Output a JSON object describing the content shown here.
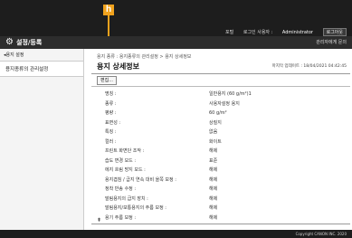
{
  "header": {
    "links": [
      "포털",
      "로그인 사용자 :",
      "Administrator",
      "로그아웃"
    ],
    "logout_button": "로그아웃"
  },
  "callout": {
    "label": "h"
  },
  "appbar": {
    "title": "설정/등록",
    "portal_link": "관리자에게 문의"
  },
  "sidebar": {
    "back_label": "◂용지 설정",
    "items": [
      {
        "label": "용지종류의 관리설정"
      }
    ]
  },
  "main": {
    "breadcrumb": "용지 종류 : 용지종류의 관리설정 > 용지 상세정보",
    "title": "용지 상세정보",
    "updated": "마지막 업데이트 : 18/04/2021 04:42:45",
    "edit_button": "편집...",
    "properties": [
      {
        "key": "명칭 :",
        "value": "일반용지 (60 g/m²)1"
      },
      {
        "key": "종류 :",
        "value": "사용자설정 용지"
      },
      {
        "key": "평량 :",
        "value": "60 g/m²"
      },
      {
        "key": "표면성 :",
        "value": "상질지"
      },
      {
        "key": "특징 :",
        "value": "없음"
      },
      {
        "key": "컬러 :",
        "value": "화이트"
      },
      {
        "key": "프린트 화면단 조작 :",
        "value": "해제"
      },
      {
        "key": "습도 변경 모드 :",
        "value": "표준"
      },
      {
        "key": "에지 흐림 방지 모드 :",
        "value": "해제"
      },
      {
        "key": "용지겹침 / 급지 연속 대비 을쪽 보정 :",
        "value": "해제"
      },
      {
        "key": "정착 반송 수정 :",
        "value": "해제"
      },
      {
        "key": "말림용지의 급지 장치 :",
        "value": "해제"
      },
      {
        "key": "말림용지/보통용지의 주름 보정 :",
        "value": "해제"
      },
      {
        "key": "용기 주름 보정 :",
        "value": "해제"
      }
    ],
    "up_arrow": "⇞"
  },
  "footer": {
    "copyright": "Copyright CANON INC. 2020"
  }
}
